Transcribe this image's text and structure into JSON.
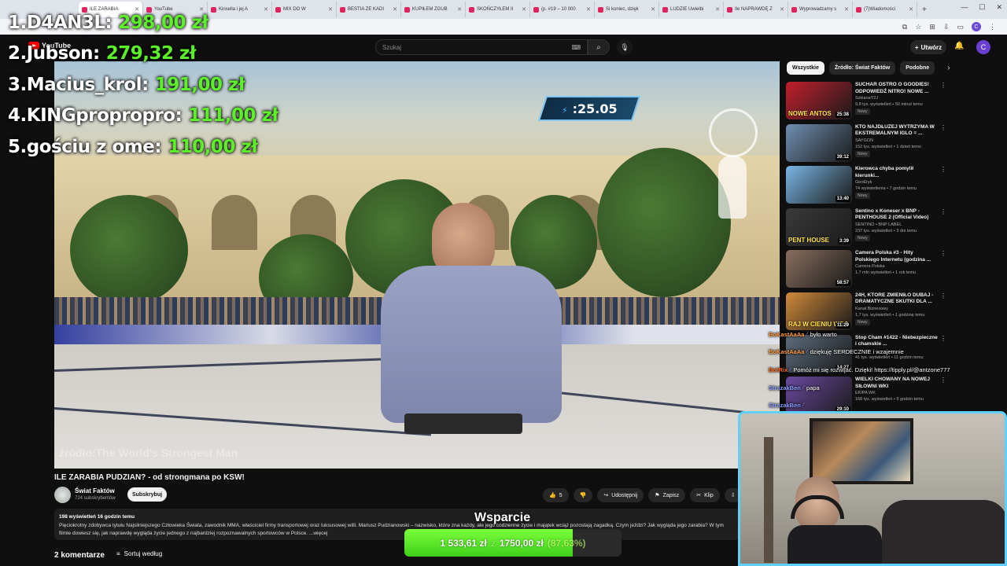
{
  "browser": {
    "tabs": [
      {
        "label": "ILE ZARABIA",
        "active": true
      },
      {
        "label": "YouTube",
        "active": false
      },
      {
        "label": "Kinsella i jej A",
        "active": false
      },
      {
        "label": "MIX DO W",
        "active": false
      },
      {
        "label": "BESTIA ZE KADI",
        "active": false
      },
      {
        "label": "KUPIŁEM ZGUB",
        "active": false
      },
      {
        "label": "SKOŃCZYŁEM II",
        "active": false
      },
      {
        "label": "(p. #19 – 10 000",
        "active": false
      },
      {
        "label": "Si koniec, dzięk",
        "active": false
      },
      {
        "label": "LUDZIE Uwielbi",
        "active": false
      },
      {
        "label": "Ile NAPRAWDĘ Z",
        "active": false
      },
      {
        "label": "Wyprowadzamy s",
        "active": false
      },
      {
        "label": "(7)Wiadomości",
        "active": false
      }
    ],
    "profile_initial": "C"
  },
  "youtube": {
    "logo_text": "YouTube",
    "search_placeholder": "Szukaj",
    "create_label": "Utwórz",
    "avatar_initial": "C"
  },
  "leaderboard": [
    {
      "rank": "1.",
      "name": "D4AN3L:",
      "amount": "298,00 zł"
    },
    {
      "rank": "2.",
      "name": "Jubson:",
      "amount": "279,32 zł"
    },
    {
      "rank": "3.",
      "name": "Macius_krol:",
      "amount": "191,00 zł"
    },
    {
      "rank": "4.",
      "name": "KINGpropropro:",
      "amount": "111,00 zł"
    },
    {
      "rank": "5.",
      "name": "gościu z ome:",
      "amount": "110,00 zł"
    }
  ],
  "video": {
    "timer": ":25.05",
    "source_watermark": "źródło:The World's Strongest Man",
    "title": "ILE ZARABIA PUDZIAN? - od strongmana po KSW!",
    "channel_name": "Świat Faktów",
    "subscriber_count": "724 subskrybentów",
    "subscribe_label": "Subskrybuj",
    "like_count": "5",
    "share_label": "Udostępnij",
    "save_label": "Zapisz",
    "clip_label": "Klip",
    "views_and_time": "198 wyświetleń  16 godzin temu",
    "description": "Pięciokrotny zdobywca tytułu Najsilniejszego Człowieka Świata, zawodnik MMA, właściciel firmy transportowej oraz luksusowej willi. Mariusz Pudzianowski – nazwisko, które zna każdy, ale jego codzienne życie i majątek wciąż pozostają zagadką. Czym jeździ? Jak wygląda jego zarabia? W tym filmie dowiesz się, jak naprawdę wygląda życie jednego z najbardziej rozpoznawalnych sportowców w Polsce. ...więcej",
    "comments_count": "2 komentarze",
    "sort_label": "Sortuj według"
  },
  "donation": {
    "label": "Wsparcie",
    "current": "1 533,61 zł",
    "separator": "z",
    "goal": "1750,00 zł",
    "percent_text": "(87,63%)",
    "progress": 0.8763
  },
  "sidebar": {
    "chips": [
      "Wszystkie",
      "Źródło: Świat Faktów",
      "Podobne"
    ],
    "recommendations": [
      {
        "title": "SUCHAR OSTRO O GOODIES! ODPOWIEDŹ NITRO! NOWE ...",
        "channel": "SzkianaY2J",
        "meta": "9,8 tys. wyświetleń • 50 minut temu",
        "badge": "Nowy",
        "duration": "25:38",
        "thumb": "#c21f2c",
        "thumb_text": "NOWE ANTOS"
      },
      {
        "title": "KTO NAJDŁUŻEJ WYTRZYMA W EKSTREMALNYM IGLO = ...",
        "channel": "SAYGON",
        "meta": "152 tys. wyświetleń • 1 dzień temu",
        "badge": "Nowy",
        "duration": "39:12",
        "thumb": "#6f8fb1",
        "thumb_text": ""
      },
      {
        "title": "Kierowca chyba pomylił kierunki...",
        "channel": "GeoEryk",
        "meta": "74 wyświetlenia • 7 godzin temu",
        "badge": "Nowy",
        "duration": "13:40",
        "thumb": "#7ab7e6",
        "thumb_text": ""
      },
      {
        "title": "Sentino x Koneser x BNP - PENTHOUSE 2 (Official Video)",
        "channel": "SENTINO • BNP LABEL",
        "meta": "237 tys. wyświetleń • 3 dni temu",
        "badge": "Nowy",
        "duration": "3:39",
        "thumb": "#3a3a3a",
        "thumb_text": "PENT HOUSE"
      },
      {
        "title": "Camera Polska #3 - Hity Polskiego Internetu (godzina ...",
        "channel": "Camera Polska",
        "meta": "1,7 mln wyświetleń • 1 rok temu",
        "badge": "",
        "duration": "58:57",
        "thumb": "#8a6f5e",
        "thumb_text": ""
      },
      {
        "title": "24H, KTÓRE ZMIENIŁO DUBAJ - DRAMATYCZNE SKUTKI DLA ...",
        "channel": "Kanał Biznesowy",
        "meta": "1,7 tys. wyświetleń • 1 godzinę temu",
        "badge": "Nowy",
        "duration": "11:29",
        "thumb": "#d08a3a",
        "thumb_text": "RAJ W CIENIU WOJ"
      },
      {
        "title": "Stop Cham #1422 - Niebezpieczne i chamskie ...",
        "channel": "",
        "meta": "41 tys. wyświetleń • 11 godzin temu",
        "badge": "",
        "duration": "14:27",
        "thumb": "#5c6c7c",
        "thumb_text": ""
      },
      {
        "title": "WIELKI CHOWANY NA NOWEJ SIŁOWNI WKI",
        "channel": "EKIPA WK",
        "meta": "168 tys. wyświetleń • 9 godzin temu",
        "badge": "",
        "duration": "29:10",
        "thumb": "#6b4aa0",
        "thumb_text": ""
      }
    ]
  },
  "chat": [
    {
      "user": "BoKastAaAa",
      "color": "#ff9a3c",
      "text": "było warto"
    },
    {
      "user": "BoKastAaAa",
      "color": "#ff9a3c",
      "text": "dziękuję SERDECZNIE i wzajemnie"
    },
    {
      "user": "BotRix",
      "color": "#ff6a1a",
      "text": "Pomóż mi się rozwijać. Dzięki! https://tipply.pl/@antzone777"
    },
    {
      "user": "StrazakBen",
      "color": "#8aa0ff",
      "text": "papa"
    },
    {
      "user": "StrazakBen",
      "color": "#8aa0ff",
      "text": ""
    }
  ]
}
